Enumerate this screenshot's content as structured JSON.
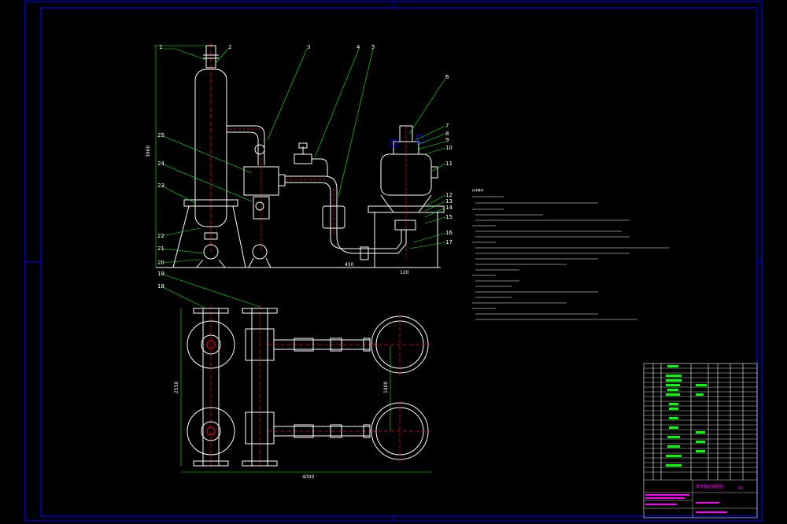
{
  "callouts_top": [
    "1",
    "2",
    "3",
    "4",
    "5",
    "6",
    "7",
    "8",
    "9",
    "10",
    "11",
    "12",
    "13",
    "14",
    "15",
    "16",
    "17"
  ],
  "callouts_left": [
    "25",
    "24",
    "23",
    "22",
    "21",
    "20"
  ],
  "callouts_plan": [
    "19",
    "18"
  ],
  "dimensions": {
    "height_total": "3900",
    "base_span": "450",
    "base_right": "120",
    "plan_height": "2550",
    "plan_width": "4000",
    "plan_right": "1800"
  },
  "notes_title": "技术要求",
  "title_block": {
    "drawing_title": "蒸发器总装配图",
    "scale": "A1"
  },
  "colors": {
    "frame": "#0000ff",
    "lines": "#ffffff",
    "leaders": "#00ff00",
    "pipes": "#ff0000",
    "titleblock_text": "#ff00ff",
    "parts_text": "#00ff00"
  }
}
